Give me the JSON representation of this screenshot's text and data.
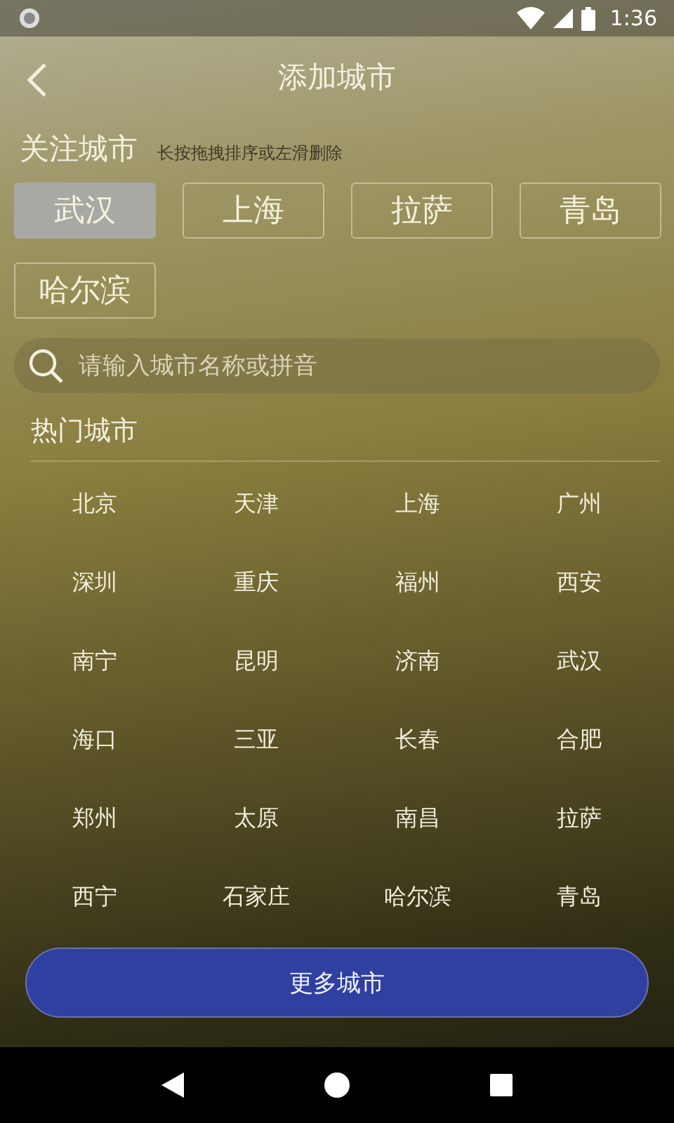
{
  "status_bar": {
    "time": "1:36"
  },
  "header": {
    "title": "添加城市"
  },
  "followed": {
    "title": "关注城市",
    "hint": "长按拖拽排序或左滑删除",
    "cities": [
      {
        "name": "武汉",
        "selected": true
      },
      {
        "name": "上海",
        "selected": false
      },
      {
        "name": "拉萨",
        "selected": false
      },
      {
        "name": "青岛",
        "selected": false
      },
      {
        "name": "哈尔滨",
        "selected": false
      }
    ]
  },
  "search": {
    "placeholder": "请输入城市名称或拼音"
  },
  "hot": {
    "title": "热门城市",
    "cities": [
      "北京",
      "天津",
      "上海",
      "广州",
      "深圳",
      "重庆",
      "福州",
      "西安",
      "南宁",
      "昆明",
      "济南",
      "武汉",
      "海口",
      "三亚",
      "长春",
      "合肥",
      "郑州",
      "太原",
      "南昌",
      "拉萨",
      "西宁",
      "石家庄",
      "哈尔滨",
      "青岛"
    ]
  },
  "more_button": {
    "label": "更多城市"
  }
}
